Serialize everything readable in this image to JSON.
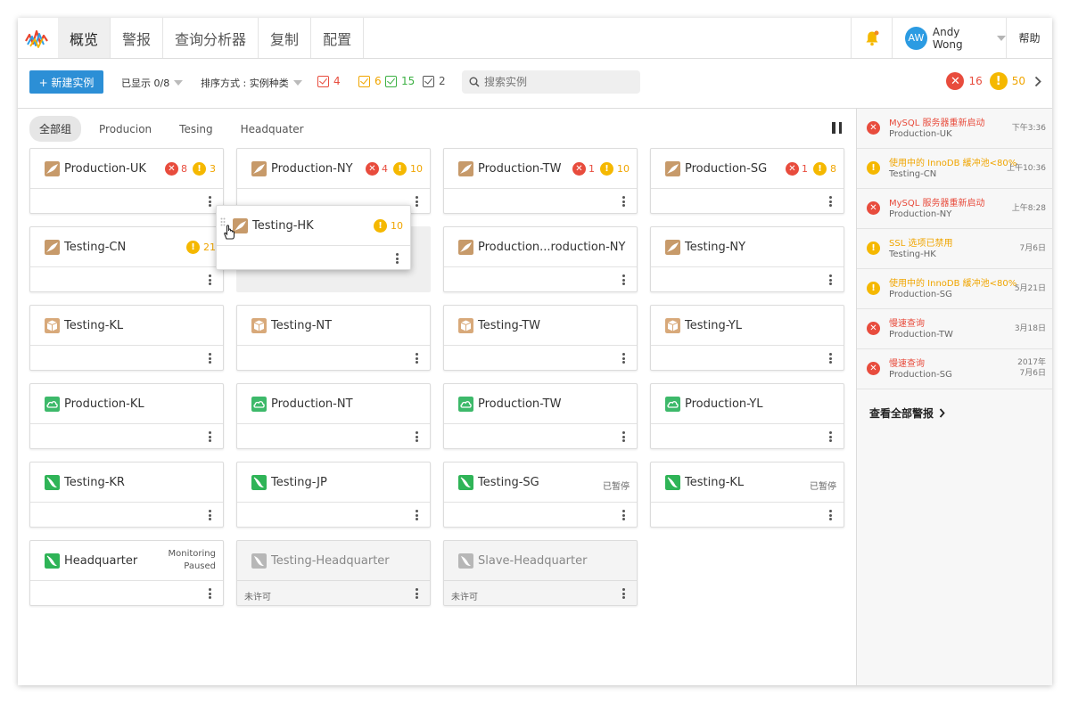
{
  "nav": {
    "tabs": [
      "概览",
      "警报",
      "查询分析器",
      "复制",
      "配置"
    ],
    "active_tab": "概览",
    "user_initials": "AW",
    "user_name": "Andy Wong",
    "help": "帮助"
  },
  "toolbar": {
    "new_button": "+ 新建实例",
    "shown": "已显示 0/8",
    "sort": "排序方式 : 实例种类",
    "filters": [
      {
        "count": "4",
        "color": "#e84c3d"
      },
      {
        "count": "6",
        "color": "#f0a500"
      },
      {
        "count": "15",
        "color": "#3cb043"
      },
      {
        "count": "2",
        "color": "#555555"
      }
    ],
    "search_placeholder": "搜索实例",
    "errors_count": "16",
    "warnings_count": "50"
  },
  "groups": [
    "全部组",
    "Producion",
    "Tesing",
    "Headquater"
  ],
  "cards": [
    {
      "name": "Production-UK",
      "icon": "mysql-orange",
      "err": "8",
      "warn": "3"
    },
    {
      "name": "Production-NY",
      "icon": "mysql-orange",
      "err": "4",
      "warn": "10"
    },
    {
      "name": "Production-TW",
      "icon": "mysql-orange",
      "err": "1",
      "warn": "10"
    },
    {
      "name": "Production-SG",
      "icon": "mysql-orange",
      "err": "1",
      "warn": "8"
    },
    {
      "name": "Testing-CN",
      "icon": "mysql-orange",
      "warn": "21"
    },
    {
      "name": "Production...roduction-NY",
      "icon": "mysql-orange"
    },
    {
      "name": "Testing-NY",
      "icon": "mysql-orange"
    },
    {
      "name": "Testing-KL",
      "icon": "box-orange"
    },
    {
      "name": "Testing-NT",
      "icon": "box-orange"
    },
    {
      "name": "Testing-TW",
      "icon": "box-orange"
    },
    {
      "name": "Testing-YL",
      "icon": "box-orange"
    },
    {
      "name": "Production-KL",
      "icon": "cloud-green"
    },
    {
      "name": "Production-NT",
      "icon": "cloud-green"
    },
    {
      "name": "Production-TW",
      "icon": "cloud-green"
    },
    {
      "name": "Production-YL",
      "icon": "cloud-green"
    },
    {
      "name": "Testing-KR",
      "icon": "mariadb-green"
    },
    {
      "name": "Testing-JP",
      "icon": "mariadb-green"
    },
    {
      "name": "Testing-SG",
      "icon": "mariadb-green",
      "paused": "已暂停"
    },
    {
      "name": "Testing-KL",
      "icon": "mariadb-green",
      "paused": "已暂停"
    },
    {
      "name": "Headquarter",
      "icon": "mariadb-green",
      "monitoring": [
        "Monitoring",
        "Paused"
      ]
    },
    {
      "name": "Testing-Headquarter",
      "icon": "mariadb-gray",
      "unlicensed": "未许可"
    },
    {
      "name": "Slave-Headquarter",
      "icon": "mariadb-gray",
      "unlicensed": "未许可"
    }
  ],
  "drag_card": {
    "name": "Testing-HK",
    "warn": "10"
  },
  "alerts": [
    {
      "level": "error",
      "title": "MySQL 服务器重新启动",
      "instance": "Production-UK",
      "time": [
        "下午3:36"
      ]
    },
    {
      "level": "warning",
      "title": "使用中的 InnoDB 緩冲池<80%",
      "instance": "Testing-CN",
      "time": [
        "上午10:36"
      ]
    },
    {
      "level": "error",
      "title": "MySQL 服务器重新启动",
      "instance": "Production-NY",
      "time": [
        "上午8:28"
      ]
    },
    {
      "level": "warning",
      "title": "SSL 选项已禁用",
      "instance": "Testing-HK",
      "time": [
        "7月6日"
      ]
    },
    {
      "level": "warning",
      "title": "使用中的 InnoDB 緩冲池<80%",
      "instance": "Production-SG",
      "time": [
        "5月21日"
      ]
    },
    {
      "level": "error",
      "title": "慢速查询",
      "instance": "Production-TW",
      "time": [
        "3月18日"
      ]
    },
    {
      "level": "error",
      "title": "慢速查询",
      "instance": "Production-SG",
      "time": [
        "2017年",
        "7月6日"
      ]
    }
  ],
  "view_all": "查看全部警报"
}
